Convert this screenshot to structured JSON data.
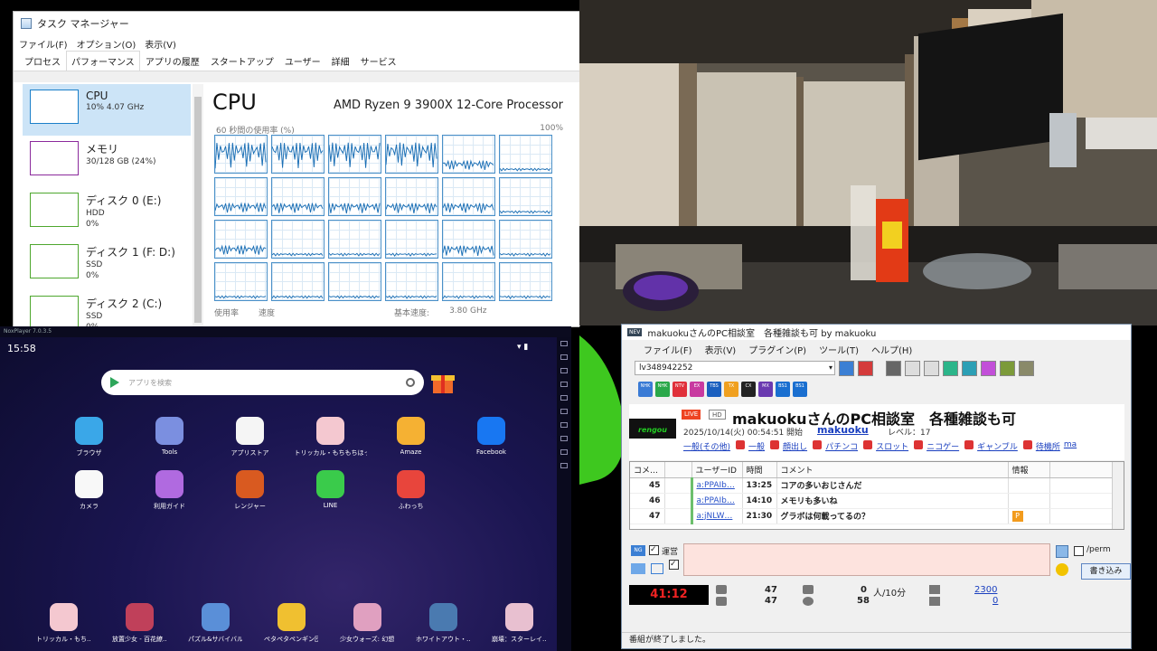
{
  "task_manager": {
    "title": "タスク マネージャー",
    "menu": [
      "ファイル(F)",
      "オプション(O)",
      "表示(V)"
    ],
    "tabs": [
      "プロセス",
      "パフォーマンス",
      "アプリの履歴",
      "スタートアップ",
      "ユーザー",
      "詳細",
      "サービス"
    ],
    "active_tab": 1,
    "side": [
      {
        "name": "CPU",
        "sub1": "10% 4.07 GHz",
        "sub2": "",
        "sub3": "",
        "color": "#1b7fc9"
      },
      {
        "name": "メモリ",
        "sub1": "30/128 GB (24%)",
        "sub2": "",
        "sub3": "",
        "color": "#8b2a9c"
      },
      {
        "name": "ディスク 0 (E:)",
        "sub1": "HDD",
        "sub2": "0%",
        "sub3": "",
        "color": "#4ea72e"
      },
      {
        "name": "ディスク 1 (F: D:)",
        "sub1": "SSD",
        "sub2": "0%",
        "sub3": "",
        "color": "#4ea72e"
      },
      {
        "name": "ディスク 2 (C:)",
        "sub1": "SSD",
        "sub2": "0%",
        "sub3": "",
        "color": "#4ea72e"
      }
    ],
    "cpu_title": "CPU",
    "cpu_model": "AMD Ryzen 9 3900X 12-Core Processor",
    "util_label": "60 秒間の使用率 (%)",
    "util_max": "100%",
    "footer": [
      "使用率",
      "速度",
      "基本速度:",
      "3.80 GHz"
    ]
  },
  "emulator": {
    "title": "NoxPlayer 7.0.3.5",
    "time": "15:58",
    "search_placeholder": "アプリを検索",
    "apps": [
      {
        "label": "ブラウザ",
        "color": "#3aa7e8"
      },
      {
        "label": "Tools",
        "color": "#7b8fe0"
      },
      {
        "label": "アプリストア",
        "color": "#f5f5f5"
      },
      {
        "label": "トリッカル・もちもちほっぺ大作戦",
        "color": "#f4c8d0"
      },
      {
        "label": "Amaze",
        "color": "#f5b133"
      },
      {
        "label": "Facebook",
        "color": "#1877f2"
      },
      {
        "label": "カメラ",
        "color": "#f8f8f8"
      },
      {
        "label": "利用ガイド",
        "color": "#b06ae0"
      },
      {
        "label": "レンジャー",
        "color": "#d95a20"
      },
      {
        "label": "LINE",
        "color": "#3acb4b"
      },
      {
        "label": "ふわっち",
        "color": "#e8453c"
      }
    ],
    "dock": [
      {
        "label": "トリッカル・もち…",
        "color": "#f4c8d0"
      },
      {
        "label": "放置少女 - 百花繚…",
        "color": "#c0405a"
      },
      {
        "label": "パズル&サバイバル",
        "color": "#5a8fd8"
      },
      {
        "label": "ペタペタペンギン団",
        "color": "#f0c030"
      },
      {
        "label": "少女ウォーズ: 幻想…",
        "color": "#e0a0c0"
      },
      {
        "label": "ホワイトアウト・…",
        "color": "#4a7ab0"
      },
      {
        "label": "崩壊：スターレイ…",
        "color": "#e8c0d0"
      }
    ]
  },
  "viewer": {
    "window_title": "makuokuさんのPC相談室　各種雑談も可 by makuoku",
    "menu": [
      "ファイル(F)",
      "表示(V)",
      "プラグイン(P)",
      "ツール(T)",
      "ヘルプ(H)"
    ],
    "live_id": "lv348942252",
    "channels": [
      {
        "label": "NHK",
        "color": "#3a7bd5"
      },
      {
        "label": "NHK",
        "color": "#2aa84a"
      },
      {
        "label": "NTV",
        "color": "#e0303a"
      },
      {
        "label": "EX",
        "color": "#c83aa0"
      },
      {
        "label": "TBS",
        "color": "#1a5fbf"
      },
      {
        "label": "TX",
        "color": "#f0a020"
      },
      {
        "label": "CX",
        "color": "#222222"
      },
      {
        "label": "MX",
        "color": "#6a3ab0"
      },
      {
        "label": "BS1",
        "color": "#1a6fd0"
      },
      {
        "label": "BS1",
        "color": "#1a6fd0"
      }
    ],
    "live_badge": "LIVE",
    "hd_badge": "HD",
    "program_title": "makuokuさんのPC相談室　各種雑談も可",
    "start_date": "2025/10/14(火) 00:54:51 開始",
    "owner": "makuoku",
    "level": "レベル：17",
    "tags": [
      "一般(その他)",
      "一般",
      "顔出し",
      "パチンコ",
      "スロット",
      "ニコゲー",
      "ギャンブル",
      "待機所",
      "ma"
    ],
    "columns": [
      "コメ…",
      "",
      "ユーザーID",
      "時間",
      "コメント",
      "情報"
    ],
    "comments": [
      {
        "no": "45",
        "uid": "a:PPAIb…",
        "time": "13:25",
        "text": "コアの多いおじさんだ",
        "info": ""
      },
      {
        "no": "46",
        "uid": "a:PPAIb…",
        "time": "14:10",
        "text": "メモリも多いね",
        "info": ""
      },
      {
        "no": "47",
        "uid": "a:jNLW…",
        "time": "21:30",
        "text": "グラボは何載ってるの？",
        "info": "P"
      }
    ],
    "unei_label": "運営",
    "perm_label": "/perm",
    "post_button": "書き込み",
    "timer": "41:12",
    "stat_comments_1": "47",
    "stat_comments_2": "47",
    "stat_viewers_now": "0",
    "stat_per10": "人/10分",
    "stat_viewers_total": "58",
    "stat_ad_1": "2300",
    "stat_ad_2": "0",
    "status_text": "番組が終了しました。"
  }
}
